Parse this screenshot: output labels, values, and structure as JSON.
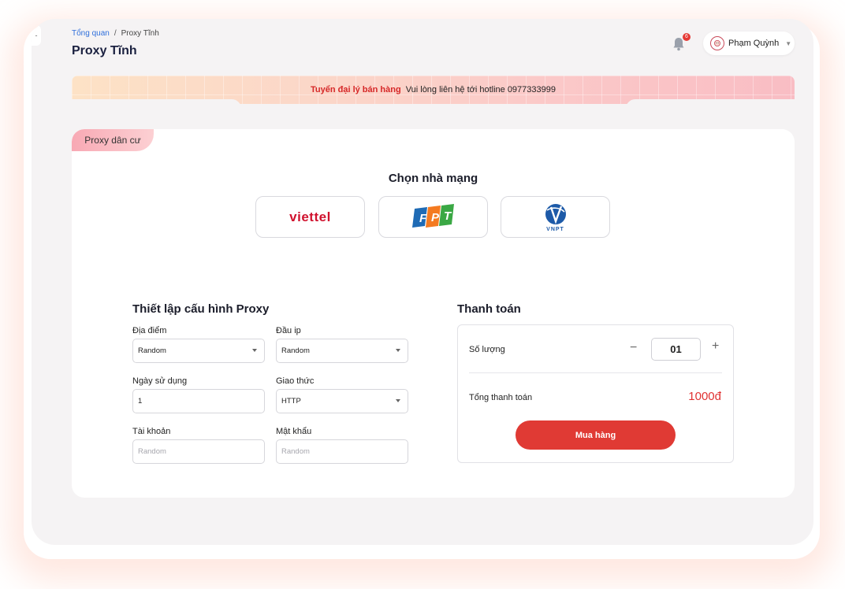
{
  "breadcrumb": {
    "home": "Tổng quan",
    "separator": "/",
    "current": "Proxy Tĩnh"
  },
  "page": {
    "title": "Proxy Tĩnh"
  },
  "header": {
    "notification_count": "6",
    "user_name": "Phạm Quỳnh"
  },
  "banner": {
    "highlight": "Tuyển đại lý bán hàng",
    "text": "Vui lòng liên hệ tới hotline 0977333999"
  },
  "card": {
    "tab_label": "Proxy dân cư",
    "section_title": "Chọn nhà mạng"
  },
  "carriers": [
    {
      "name": "viettel",
      "brand_color": "#d0122e"
    },
    {
      "name": "FPT",
      "brand_colors": [
        "#1f6bb5",
        "#f47a20",
        "#3aa844"
      ]
    },
    {
      "name": "VNPT",
      "brand_color": "#1d5aa8"
    }
  ],
  "config": {
    "title": "Thiết lập cấu hình Proxy",
    "location_label": "Địa điểm",
    "location_value": "Random",
    "ip_prefix_label": "Đầu ip",
    "ip_prefix_value": "Random",
    "days_label": "Ngày sử dụng",
    "days_value": "1",
    "protocol_label": "Giao thức",
    "protocol_value": "HTTP",
    "account_label": "Tài khoản",
    "account_placeholder": "Random",
    "password_label": "Mật khẩu",
    "password_placeholder": "Random"
  },
  "payment": {
    "title": "Thanh toán",
    "quantity_label": "Số lượng",
    "quantity_value": "01",
    "minus": "−",
    "plus": "+",
    "total_label": "Tổng thanh toán",
    "total_value": "1000đ",
    "buy_label": "Mua hàng"
  },
  "colors": {
    "accent_red": "#e03a34",
    "link_blue": "#2f6fdb"
  }
}
